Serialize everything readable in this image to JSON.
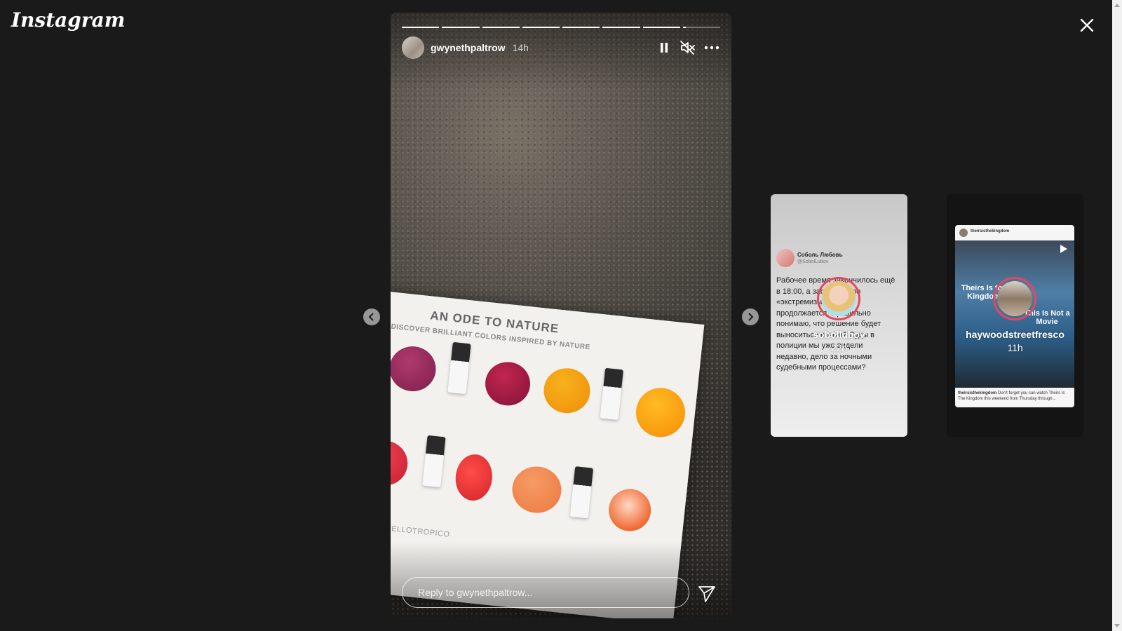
{
  "app": {
    "logo": "Instagram"
  },
  "story": {
    "username": "gwynethpaltrow",
    "time": "14h",
    "segments": 8,
    "active_segment": 8,
    "active_progress": 0.08,
    "reply_placeholder": "Reply to gwynethpaltrow...",
    "card_title": "AN ODE TO NATURE",
    "card_subtitle": "DISCOVER BRILLIANT COLORS INSPIRED BY NATURE",
    "card_tag": "#ELLOTROPICO",
    "icons": [
      "pause-icon",
      "mute-icon",
      "more-options-icon",
      "send-icon"
    ]
  },
  "previews": [
    {
      "username": "sobollubov",
      "time": "22h",
      "tweet": {
        "name": "Соболь Любовь",
        "handle": "@SobolLubov",
        "text": "Рабочее время закончилось ещё в 18:00, а заседание по «экстремизму» ФБК продолжается. Правильно понимаю, что решение будет выноситься ночью? Суды в полиции мы уже видели недавно, дело за ночными судебными процессами?"
      }
    },
    {
      "username": "haywoodstreetfresco",
      "time": "11h",
      "post": {
        "account": "theirsisthekingdom",
        "caption_user": "theirsisthekingdom",
        "caption": "Don't forget you can watch Theirs Is The Kingdom this weekend from Thursday through...",
        "overlay_left": "Theirs Is the Kingdom",
        "overlay_right": "This Is Not a Movie"
      }
    }
  ],
  "colors": {
    "background": "#1a1a1a",
    "ring": "#e6475c",
    "text": "#ffffff"
  }
}
